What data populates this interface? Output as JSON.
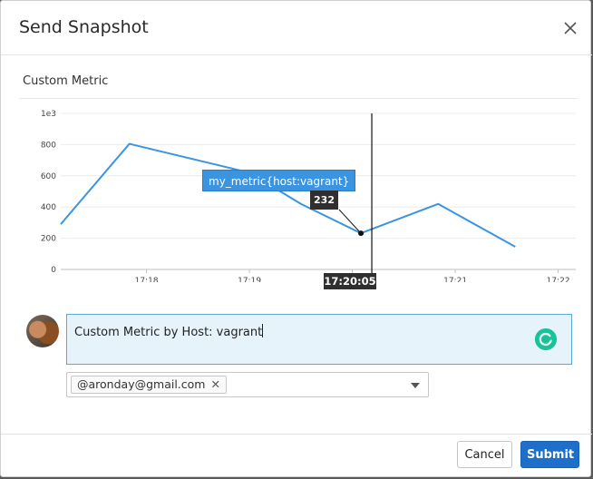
{
  "dialog": {
    "title": "Send Snapshot"
  },
  "graph": {
    "title": "Custom Metric",
    "tooltip": {
      "series": "my_metric{host:vagrant}",
      "value": "232",
      "time": "17:20:05"
    }
  },
  "chart_data": {
    "type": "line",
    "title": "Custom Metric",
    "series": [
      {
        "name": "my_metric{host:vagrant}",
        "x": [
          "17:17:10",
          "17:17:50",
          "17:19:00",
          "17:19:30",
          "17:20:05",
          "17:20:50",
          "17:21:35"
        ],
        "y": [
          290,
          805,
          620,
          420,
          232,
          420,
          145
        ]
      }
    ],
    "y_ticks": [
      "0",
      "200",
      "400",
      "600",
      "800",
      "1e3"
    ],
    "x_ticks": [
      "17:18",
      "17:19",
      "17:20",
      "17:21",
      "17:22"
    ],
    "ylim": [
      0,
      1000
    ],
    "grid": true,
    "cursor_time": "17:20:05",
    "color": "#3b94e0"
  },
  "message": {
    "text": "Custom Metric by Host: vagrant"
  },
  "recipients": {
    "items": [
      {
        "label": "@aronday@gmail.com"
      }
    ]
  },
  "buttons": {
    "cancel": "Cancel",
    "submit": "Submit"
  },
  "icons": {
    "close": "close-icon",
    "grammarly": "grammarly-icon",
    "remove": "remove-icon",
    "dropdown": "chevron-down-icon"
  }
}
